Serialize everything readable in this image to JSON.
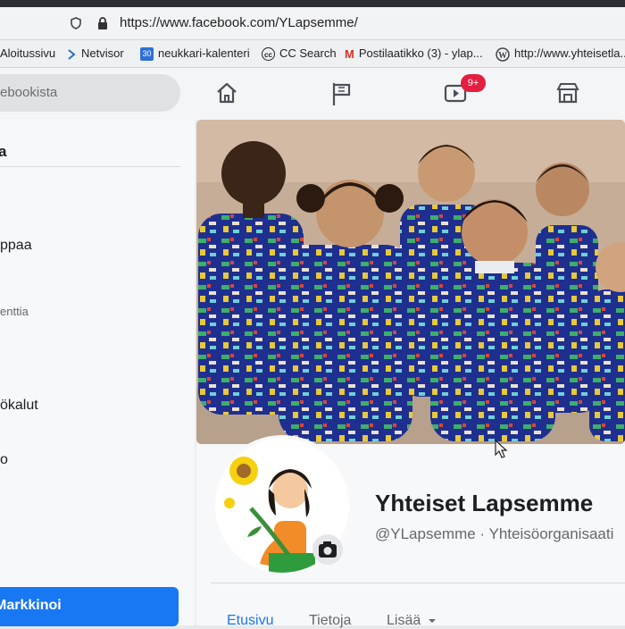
{
  "browser": {
    "url": "https://www.facebook.com/YLapsemme/",
    "bookmarks": [
      {
        "label": "Aloitussivu"
      },
      {
        "label": "Netvisor"
      },
      {
        "label": "neukkari-kalenteri",
        "icon_text": "30"
      },
      {
        "label": "CC Search",
        "icon_text": "cc"
      },
      {
        "label": "Postilaatikko (3) - ylap...",
        "icon_text": "M"
      },
      {
        "label": "http://www.yhteisetla..."
      }
    ]
  },
  "facebook_nav": {
    "search_placeholder": "ebookista",
    "video_badge": "9+",
    "icons": [
      "home-icon",
      "flag-icon",
      "video-icon",
      "marketplace-icon"
    ]
  },
  "sidebar": {
    "heading": "a",
    "items": [
      "ppaa",
      "enttia",
      "ökalut",
      "o"
    ],
    "promote_button": "Markkinoi"
  },
  "page": {
    "name": "Yhteiset Lapsemme",
    "handle_line": "@YLapsemme · Yhteisöorganisaati",
    "tabs": [
      "Etusivu",
      "Tietoja",
      "Lisää"
    ]
  },
  "colors": {
    "accent": "#1877f2",
    "badge": "#e41e3f",
    "cover_wall": "#c4ab96",
    "smocks": "#1f2f8f"
  }
}
